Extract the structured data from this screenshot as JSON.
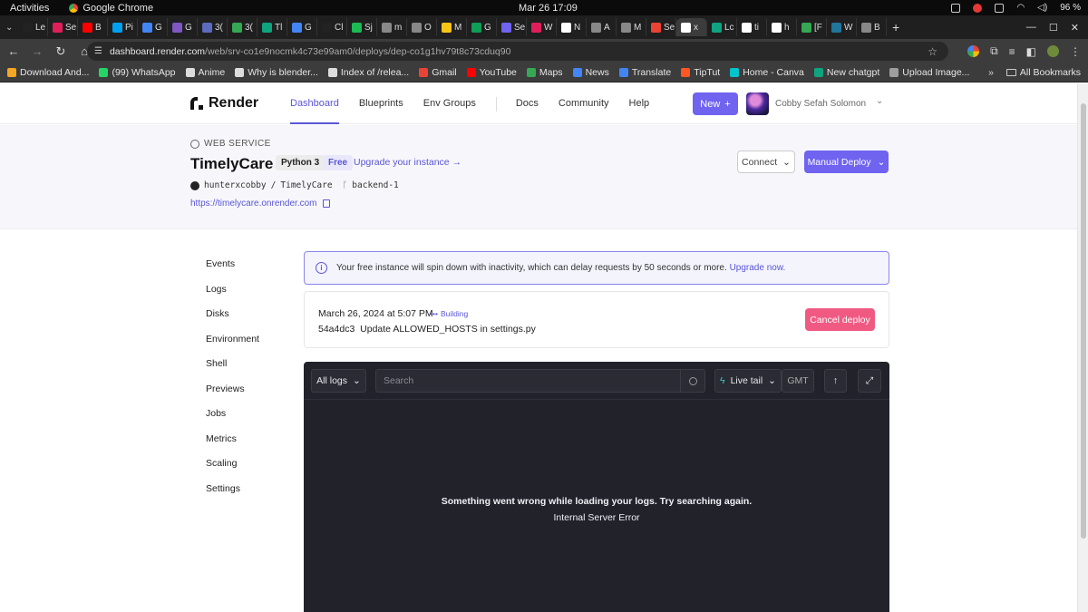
{
  "os": {
    "activities": "Activities",
    "app_name": "Google Chrome",
    "clock": "Mar 26  17:09",
    "battery": "96 %"
  },
  "tabs": [
    {
      "label": "Le",
      "color": "#222222"
    },
    {
      "label": "Se",
      "color": "#e01e5a"
    },
    {
      "label": "B",
      "color": "#ff0000"
    },
    {
      "label": "Pi",
      "color": "#00a1f1"
    },
    {
      "label": "G",
      "color": "#4285f4"
    },
    {
      "label": "G",
      "color": "#7e57c2"
    },
    {
      "label": "3(",
      "color": "#5c6bc0"
    },
    {
      "label": "3(",
      "color": "#34a853"
    },
    {
      "label": "Tl",
      "color": "#10a37f"
    },
    {
      "label": "G",
      "color": "#4285f4"
    },
    {
      "label": "Cl",
      "color": "#222222"
    },
    {
      "label": "Sj",
      "color": "#1db954"
    },
    {
      "label": "m",
      "color": "#888888"
    },
    {
      "label": "O",
      "color": "#888888"
    },
    {
      "label": "M",
      "color": "#f5c518"
    },
    {
      "label": "G",
      "color": "#0f9d58"
    },
    {
      "label": "Se",
      "color": "#6f63f0"
    },
    {
      "label": "W",
      "color": "#e01e5a"
    },
    {
      "label": "N",
      "color": "#ffffff"
    },
    {
      "label": "A",
      "color": "#888888"
    },
    {
      "label": "M",
      "color": "#888888"
    },
    {
      "label": "Se",
      "color": "#ea4335"
    },
    {
      "label": "x",
      "color": "#ffffff",
      "active": true
    },
    {
      "label": "Lc",
      "color": "#10a37f"
    },
    {
      "label": "ti",
      "color": "#ffffff"
    },
    {
      "label": "h",
      "color": "#ffffff"
    },
    {
      "label": "[F",
      "color": "#34a853"
    },
    {
      "label": "W",
      "color": "#21759b"
    },
    {
      "label": "B",
      "color": "#888888"
    }
  ],
  "address_bar": {
    "host": "dashboard.render.com",
    "path": "/web/srv-co1e9nocmk4c73e99am0/deploys/dep-co1g1hv79t8c73cduq90"
  },
  "bookmarks": [
    {
      "label": "Download And...",
      "color": "#f5a623"
    },
    {
      "label": "(99) WhatsApp",
      "color": "#25d366"
    },
    {
      "label": "Anime",
      "color": "#dddddd"
    },
    {
      "label": "Why is blender...",
      "color": "#dddddd"
    },
    {
      "label": "Index of /relea...",
      "color": "#dddddd"
    },
    {
      "label": "Gmail",
      "color": "#ea4335"
    },
    {
      "label": "YouTube",
      "color": "#ff0000"
    },
    {
      "label": "Maps",
      "color": "#34a853"
    },
    {
      "label": "News",
      "color": "#4285f4"
    },
    {
      "label": "Translate",
      "color": "#4285f4"
    },
    {
      "label": "TipTut",
      "color": "#ff5722"
    },
    {
      "label": "Home - Canva",
      "color": "#00c4cc"
    },
    {
      "label": "New chatgpt",
      "color": "#10a37f"
    },
    {
      "label": "Upload Image...",
      "color": "#9e9e9e"
    }
  ],
  "bookmarks_more": "»",
  "all_bookmarks": "All Bookmarks",
  "header": {
    "brand": "Render",
    "nav": [
      "Dashboard",
      "Blueprints",
      "Env Groups",
      "Docs",
      "Community",
      "Help"
    ],
    "new_button": "New",
    "user": "Cobby Sefah Solomon"
  },
  "service": {
    "type": "WEB SERVICE",
    "name": "TimelyCare",
    "runtime": "Python 3",
    "plan": "Free",
    "upgrade_link": "Upgrade your instance →",
    "repo_owner": "hunterxcobby",
    "repo_name": "TimelyCare",
    "branch": "backend-1",
    "url": "https://timelycare.onrender.com",
    "connect_button": "Connect",
    "deploy_button": "Manual Deploy"
  },
  "sidebar": [
    "Events",
    "Logs",
    "Disks",
    "Environment",
    "Shell",
    "Previews",
    "Jobs",
    "Metrics",
    "Scaling",
    "Settings"
  ],
  "notice": {
    "text": "Your free instance will spin down with inactivity, which can delay requests by 50 seconds or more.",
    "link": "Upgrade now."
  },
  "deploy": {
    "date": "March 26, 2024 at 5:07 PM",
    "status": "Building",
    "commit_hash": "54a4dc3",
    "commit_message": "Update ALLOWED_HOSTS in settings.py",
    "cancel_button": "Cancel deploy"
  },
  "logs": {
    "filter": "All logs",
    "search_placeholder": "Search",
    "live_tail": "Live tail",
    "timezone": "GMT",
    "error_title": "Something went wrong while loading your logs. Try searching again.",
    "error_detail": "Internal Server Error"
  },
  "colors": {
    "accent": "#6f63f0",
    "danger": "#f05a82",
    "logs_bg": "#21222a"
  }
}
